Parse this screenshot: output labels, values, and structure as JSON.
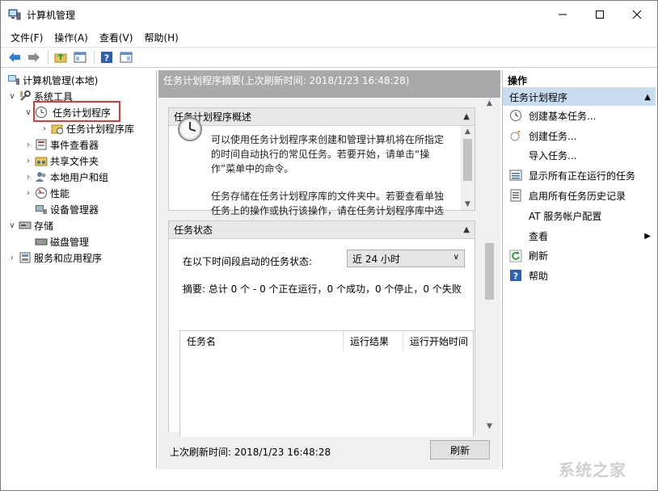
{
  "window": {
    "title": "计算机管理"
  },
  "menubar": {
    "items": [
      "文件(F)",
      "操作(A)",
      "查看(V)",
      "帮助(H)"
    ]
  },
  "tree": {
    "root": "计算机管理(本地)",
    "system_tools": "系统工具",
    "task_scheduler": "任务计划程序",
    "task_scheduler_library": "任务计划程序库",
    "event_viewer": "事件查看器",
    "shared_folders": "共享文件夹",
    "local_users_groups": "本地用户和组",
    "performance": "性能",
    "device_manager": "设备管理器",
    "storage": "存储",
    "disk_management": "磁盘管理",
    "services_apps": "服务和应用程序"
  },
  "center": {
    "header": "任务计划程序摘要(上次刷新时间: 2018/1/23 16:48:28)",
    "overview_title": "任务计划程序概述",
    "overview_p1": "可以使用任务计划程序来创建和管理计算机将在所指定的时间自动执行的常见任务。若要开始，请单击“操作”菜单中的命令。",
    "overview_p2": "任务存储在任务计划程序库的文件夹中。若要查看单独任务上的操作或执行该操作，请在任务计划程序库中选",
    "status_title": "任务状态",
    "status_label": "在以下时间段启动的任务状态:",
    "status_period": "近 24 小时",
    "summary": "摘要: 总计 0 个 - 0 个正在运行，0 个成功，0 个停止，0 个失败",
    "columns": [
      "任务名",
      "运行结果",
      "运行开始时间"
    ],
    "footer_refresh_time": "上次刷新时间: 2018/1/23 16:48:28",
    "refresh_button": "刷新"
  },
  "actions": {
    "header": "操作",
    "group": "任务计划程序",
    "items": [
      "创建基本任务...",
      "创建任务...",
      "导入任务...",
      "显示所有正在运行的任务",
      "启用所有任务历史记录",
      "AT 服务帐户配置",
      "查看",
      "刷新",
      "帮助"
    ]
  },
  "watermark": "系统之家"
}
